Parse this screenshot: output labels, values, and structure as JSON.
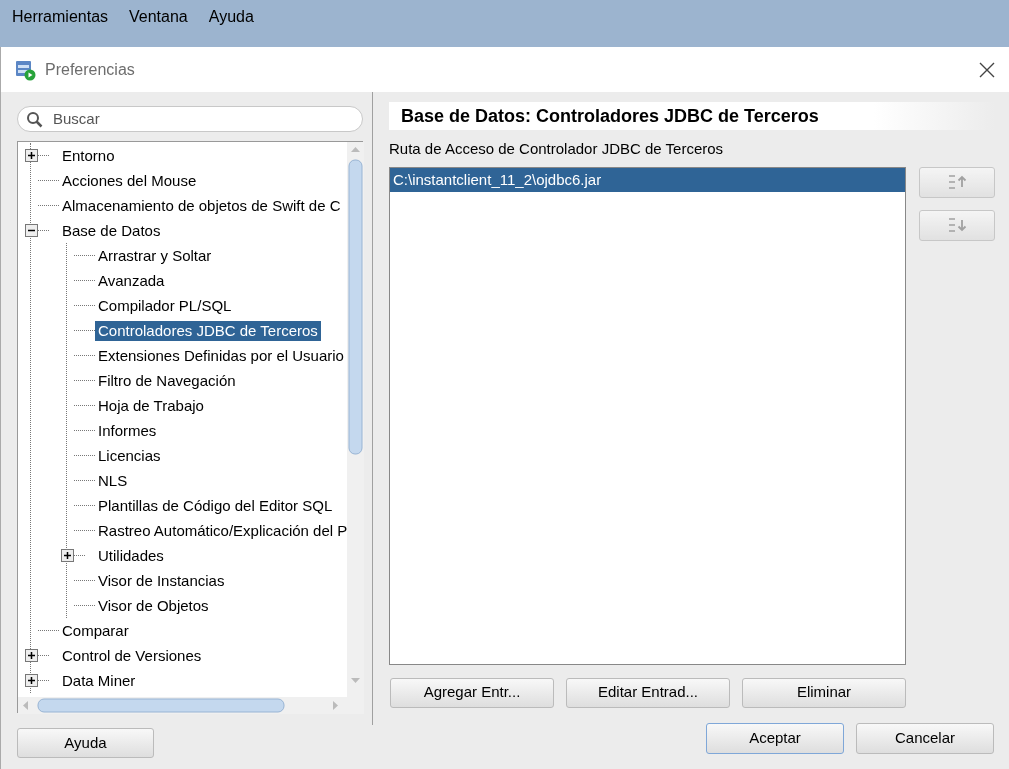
{
  "menu": [
    {
      "label": "Herramientas"
    },
    {
      "label": "Ventana"
    },
    {
      "label": "Ayuda"
    }
  ],
  "dialog": {
    "title": "Preferencias",
    "search": {
      "placeholder": "Buscar"
    },
    "tree": [
      {
        "label": "Entorno",
        "selected": false,
        "expanded": false
      },
      {
        "label": "Acciones del Mouse",
        "selected": false
      },
      {
        "label": "Almacenamiento de objetos de Swift de C",
        "selected": false
      },
      {
        "label": "Base de Datos",
        "selected": false,
        "expanded": true,
        "children": [
          {
            "label": "Arrastrar y Soltar",
            "selected": false
          },
          {
            "label": "Avanzada",
            "selected": false
          },
          {
            "label": "Compilador PL/SQL",
            "selected": false
          },
          {
            "label": "Controladores JDBC de Terceros",
            "selected": true
          },
          {
            "label": "Extensiones Definidas por el Usuario",
            "selected": false
          },
          {
            "label": "Filtro de Navegación",
            "selected": false
          },
          {
            "label": "Hoja de Trabajo",
            "selected": false
          },
          {
            "label": "Informes",
            "selected": false
          },
          {
            "label": "Licencias",
            "selected": false
          },
          {
            "label": "NLS",
            "selected": false
          },
          {
            "label": "Plantillas de Código del Editor SQL",
            "selected": false
          },
          {
            "label": "Rastreo Automático/Explicación del P",
            "selected": false
          },
          {
            "label": "Utilidades",
            "selected": false,
            "expanded": false
          },
          {
            "label": "Visor de Instancias",
            "selected": false
          },
          {
            "label": "Visor de Objetos",
            "selected": false
          }
        ]
      },
      {
        "label": "Comparar",
        "selected": false
      },
      {
        "label": "Control de Versiones",
        "selected": false,
        "expanded": false
      },
      {
        "label": "Data Miner",
        "selected": false,
        "expanded": false
      }
    ],
    "panel_title": "Base de Datos: Controladores JDBC de Terceros",
    "list_label": "Ruta de Acceso de Controlador JDBC de Terceros",
    "entries": [
      {
        "path": "C:\\instantclient_11_2\\ojdbc6.jar",
        "selected": true
      }
    ],
    "move_buttons": [
      {
        "kind": "up",
        "disabled": true
      },
      {
        "kind": "down",
        "disabled": true
      }
    ],
    "entry_buttons": [
      "Agregar Entr...",
      "Editar Entrad...",
      "Eliminar"
    ],
    "help_button": "Ayuda",
    "footer_buttons": [
      {
        "label": "Aceptar",
        "default": true
      },
      {
        "label": "Cancelar",
        "default": false
      }
    ]
  }
}
